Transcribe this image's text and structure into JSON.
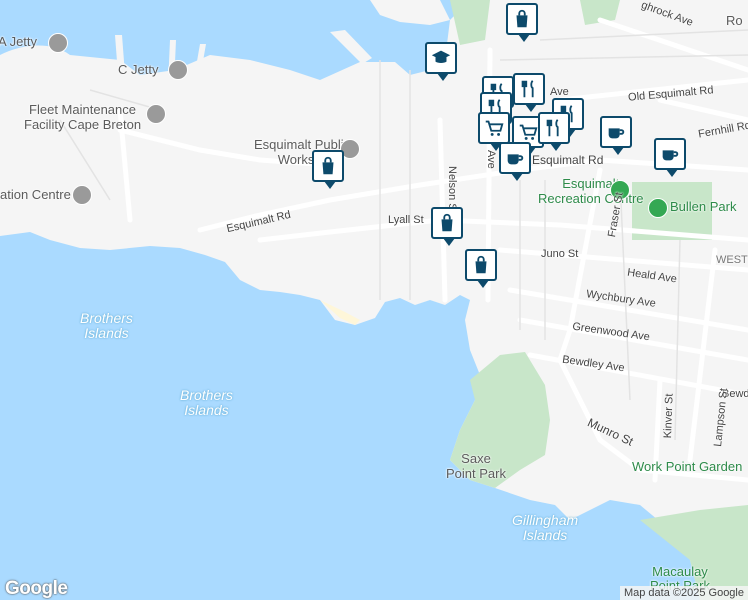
{
  "map": {
    "water_color": "#aadaff",
    "land_color": "#f5f5f5",
    "park_color": "#c8e6c9",
    "pin_color": "#0d4a6b",
    "labels": {
      "a_jetty": "A Jetty",
      "c_jetty": "C Jetty",
      "fleet": "Fleet Maintenance",
      "fleet2": "Facility Cape Breton",
      "ation_centre": "ation Centre",
      "works1": "Esquimalt Public",
      "works2": "Works Y",
      "brothers1a": "Brothers",
      "brothers1b": "Islands",
      "brothers2a": "Brothers",
      "brothers2b": "Islands",
      "saxe1": "Saxe",
      "saxe2": "Point Park",
      "gillingham1": "Gillingham",
      "gillingham2": "Islands",
      "macaulay1": "Macaulay",
      "macaulay2": "Point Park",
      "rec1": "Esquimalt",
      "rec2": "Recreation Centre",
      "bullen": "Bullen Park",
      "workpoint": "Work Point Garden",
      "ro": "Ro"
    },
    "streets": {
      "esquimalt_rd_w": "Esquimalt Rd",
      "esquimalt_rd_e": "Esquimalt Rd",
      "old_esquimalt": "Old Esquimalt Rd",
      "lyall": "Lyall St",
      "nelson": "Nelson St",
      "juno": "Juno St",
      "heald": "Heald Ave",
      "wychbury": "Wychbury Ave",
      "greenwood": "Greenwood Ave",
      "bewdley": "Bewdley Ave",
      "bewd_e": "Bewd",
      "munro": "Munro St",
      "fraser": "Fraser St",
      "kinver": "Kinver St",
      "lampson": "Lampson St",
      "fernhill": "Fernhill Rd",
      "ghrock": "ghrock Ave",
      "west": "WEST",
      "ave": "Ave",
      "ave2": "Ave"
    },
    "pins": [
      {
        "icon": "shopping-bag-icon"
      },
      {
        "icon": "school-icon"
      },
      {
        "icon": "shopping-bag-icon"
      },
      {
        "icon": "restaurant-icon"
      },
      {
        "icon": "restaurant-icon"
      },
      {
        "icon": "restaurant-icon"
      },
      {
        "icon": "grocery-cart-icon"
      },
      {
        "icon": "grocery-cart-icon"
      },
      {
        "icon": "coffee-icon"
      },
      {
        "icon": "coffee-icon"
      },
      {
        "icon": "coffee-icon"
      },
      {
        "icon": "shopping-bag-icon"
      },
      {
        "icon": "shopping-bag-icon"
      }
    ]
  },
  "footer": {
    "logo": "Google",
    "attribution": "Map data ©2025 Google"
  }
}
